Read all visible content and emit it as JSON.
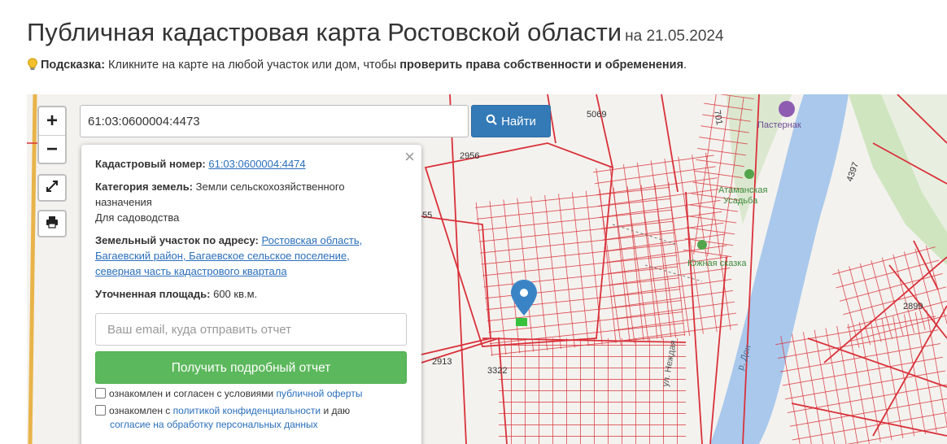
{
  "header": {
    "title": "Публичная кадастровая карта Ростовской области",
    "date": "на 21.05.2024"
  },
  "hint": {
    "label": "Подсказка:",
    "text": " Кликните на карте на любой участок или дом, чтобы ",
    "bold_text": "проверить права собственности и обременения",
    "end": "."
  },
  "map": {
    "zoom_in": "+",
    "zoom_out": "−",
    "labels": {
      "p5069": "5069",
      "p2956": "2956",
      "p55": "55",
      "p2913": "2913",
      "p3322": "3322",
      "p2899": "2899",
      "p4397": "4397",
      "p701": "701",
      "pasternak": "Пастернак",
      "usadba_1": "Атаманская",
      "usadba_2": "Усадьба",
      "skazka": "Южная сказка",
      "river": "р. Дон",
      "street": "ул. Неждая"
    },
    "colors": {
      "parcel_line": "#d9313a",
      "water": "#a9c8ec",
      "green": "#cfe5c0",
      "marker": "#3a84c6",
      "selected_parcel": "#36c23c"
    }
  },
  "search": {
    "value": "61:03:0600004:4473",
    "button_label": "Найти"
  },
  "popup": {
    "close": "×",
    "cadastral_label": "Кадастровый номер:",
    "cadastral_value": "61:03:0600004:4474",
    "category_label": "Категория земель:",
    "category_value_1": " Земли сельскохозяйственного",
    "category_value_2": "назначения",
    "usage": "Для садоводства",
    "address_label": "Земельный участок по адресу:",
    "address_line_1": "Ростовская область,",
    "address_line_2": "Багаевский район, Багаевское сельское поселение,",
    "address_line_3": "северная часть кадастрового квартала",
    "area_label": "Уточненная площадь:",
    "area_value": " 600 кв.м.",
    "email_placeholder": "Ваш email, куда отправить отчет",
    "report_button": "Получить подробный отчет",
    "agree_1_text": "ознакомлен и согласен с условиями ",
    "agree_1_link": "публичной оферты",
    "agree_2_text": "ознакомлен с ",
    "agree_2_link": "политикой конфиденциальности",
    "agree_2_end": " и даю",
    "agree_2_link2": "согласие на обработку персональных данных"
  }
}
